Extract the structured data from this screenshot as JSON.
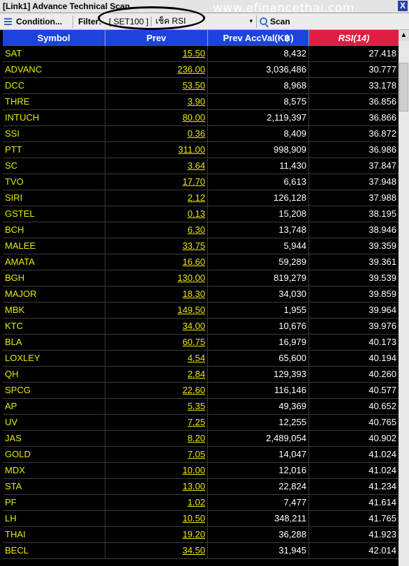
{
  "window": {
    "title": "[Link1] Advance Technical Scan",
    "close_label": "X",
    "watermark": "www.efinancethai.com"
  },
  "toolbar": {
    "condition_label": "Condition...",
    "filter_label": "Filter:",
    "filter_value": "[ SET100 ]",
    "filter_option": "เช็ค RSI",
    "dropdown_arrow": "▾",
    "scan_label": "Scan"
  },
  "table": {
    "headers": {
      "symbol": "Symbol",
      "prev": "Prev",
      "accval": "Prev AccVal(K฿)",
      "rsi": "RSI(14)"
    },
    "rows": [
      {
        "symbol": "SAT",
        "prev": "15.50",
        "accval": "8,432",
        "rsi": "27.418"
      },
      {
        "symbol": "ADVANC",
        "prev": "236.00",
        "accval": "3,036,486",
        "rsi": "30.777"
      },
      {
        "symbol": "DCC",
        "prev": "53.50",
        "accval": "8,968",
        "rsi": "33.178"
      },
      {
        "symbol": "THRE",
        "prev": "3.90",
        "accval": "8,575",
        "rsi": "36.856"
      },
      {
        "symbol": "INTUCH",
        "prev": "80.00",
        "accval": "2,119,397",
        "rsi": "36.866"
      },
      {
        "symbol": "SSI",
        "prev": "0.36",
        "accval": "8,409",
        "rsi": "36.872"
      },
      {
        "symbol": "PTT",
        "prev": "311.00",
        "accval": "998,909",
        "rsi": "36.986"
      },
      {
        "symbol": "SC",
        "prev": "3.64",
        "accval": "11,430",
        "rsi": "37.847"
      },
      {
        "symbol": "TVO",
        "prev": "17.70",
        "accval": "6,613",
        "rsi": "37.948"
      },
      {
        "symbol": "SIRI",
        "prev": "2.12",
        "accval": "126,128",
        "rsi": "37.988"
      },
      {
        "symbol": "GSTEL",
        "prev": "0.13",
        "accval": "15,208",
        "rsi": "38.195"
      },
      {
        "symbol": "BCH",
        "prev": "6.30",
        "accval": "13,748",
        "rsi": "38.946"
      },
      {
        "symbol": "MALEE",
        "prev": "33.75",
        "accval": "5,944",
        "rsi": "39.359"
      },
      {
        "symbol": "AMATA",
        "prev": "16.60",
        "accval": "59,289",
        "rsi": "39.361"
      },
      {
        "symbol": "BGH",
        "prev": "130.00",
        "accval": "819,279",
        "rsi": "39.539"
      },
      {
        "symbol": "MAJOR",
        "prev": "18.30",
        "accval": "34,030",
        "rsi": "39.859"
      },
      {
        "symbol": "MBK",
        "prev": "149.50",
        "accval": "1,955",
        "rsi": "39.964"
      },
      {
        "symbol": "KTC",
        "prev": "34.00",
        "accval": "10,676",
        "rsi": "39.976"
      },
      {
        "symbol": "BLA",
        "prev": "60.75",
        "accval": "16,979",
        "rsi": "40.173"
      },
      {
        "symbol": "LOXLEY",
        "prev": "4.54",
        "accval": "65,600",
        "rsi": "40.194"
      },
      {
        "symbol": "QH",
        "prev": "2.84",
        "accval": "129,393",
        "rsi": "40.260"
      },
      {
        "symbol": "SPCG",
        "prev": "22.60",
        "accval": "116,146",
        "rsi": "40.577"
      },
      {
        "symbol": "AP",
        "prev": "5.35",
        "accval": "49,369",
        "rsi": "40.652"
      },
      {
        "symbol": "UV",
        "prev": "7.25",
        "accval": "12,255",
        "rsi": "40.765"
      },
      {
        "symbol": "JAS",
        "prev": "8.20",
        "accval": "2,489,054",
        "rsi": "40.902"
      },
      {
        "symbol": "GOLD",
        "prev": "7.05",
        "accval": "14,047",
        "rsi": "41.024"
      },
      {
        "symbol": "MDX",
        "prev": "10.00",
        "accval": "12,016",
        "rsi": "41.024"
      },
      {
        "symbol": "STA",
        "prev": "13.00",
        "accval": "22,824",
        "rsi": "41.234"
      },
      {
        "symbol": "PF",
        "prev": "1.02",
        "accval": "7,477",
        "rsi": "41.614"
      },
      {
        "symbol": "LH",
        "prev": "10.50",
        "accval": "348,211",
        "rsi": "41.765"
      },
      {
        "symbol": "THAI",
        "prev": "19.20",
        "accval": "36,288",
        "rsi": "41.923"
      },
      {
        "symbol": "BECL",
        "prev": "34.50",
        "accval": "31,945",
        "rsi": "42.014"
      }
    ]
  },
  "scrollbar": {
    "up_arrow": "▲"
  },
  "colors": {
    "header_blue": "#1d43df",
    "header_rsi": "#e01e43",
    "symbol_text": "#e8e800",
    "background": "#000000"
  }
}
